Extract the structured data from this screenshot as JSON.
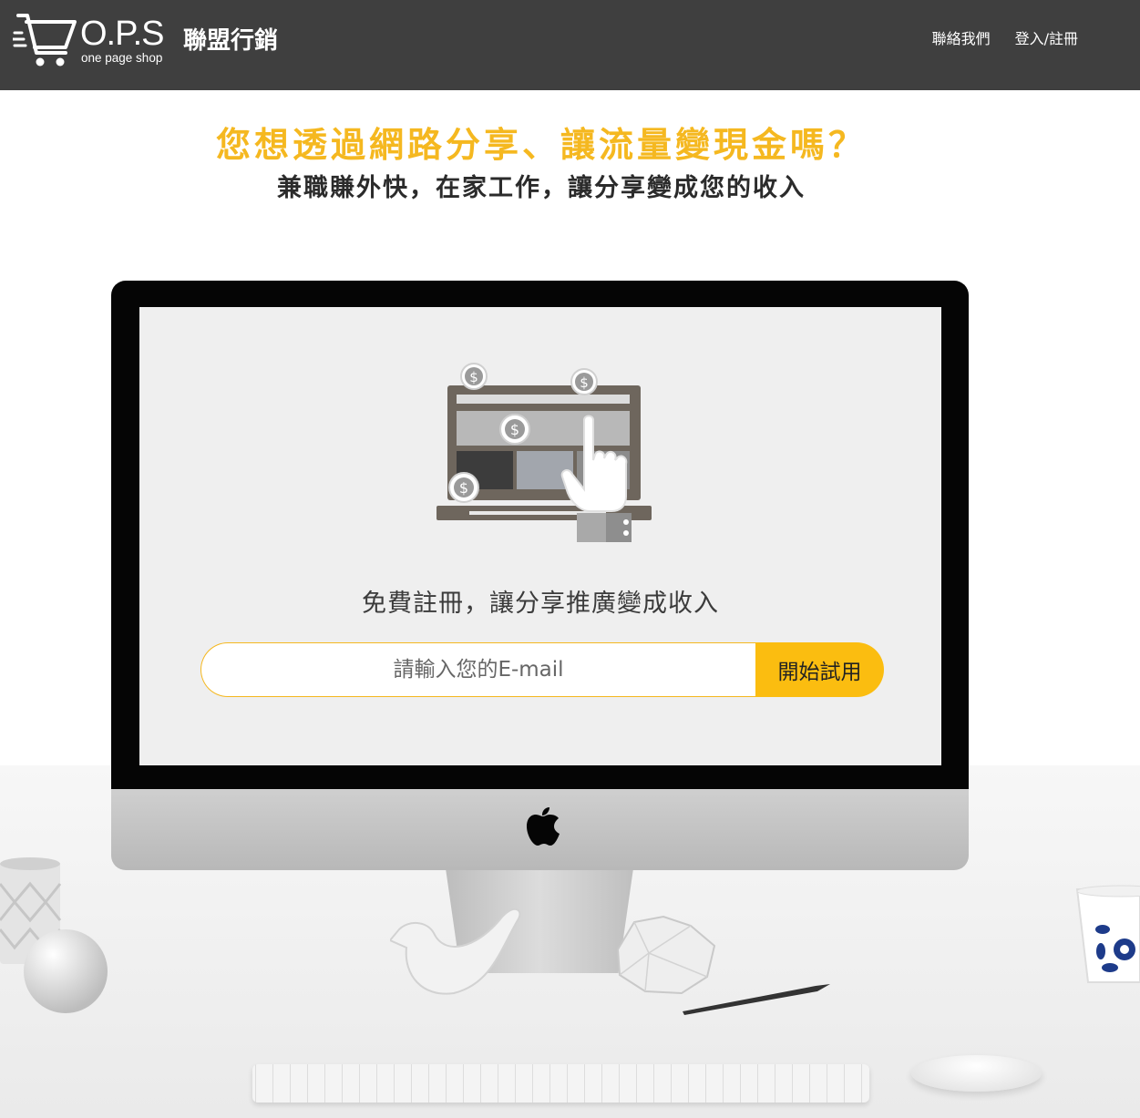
{
  "header": {
    "logo": {
      "brand": "O.P.S",
      "tagline": "one page shop"
    },
    "site_name": "聯盟行銷",
    "nav": [
      {
        "label": "聯絡我們"
      },
      {
        "label": "登入/註冊"
      }
    ]
  },
  "hero": {
    "headline": "您想透過網路分享、讓流量變現金嗎？",
    "subheadline": "兼職賺外快，在家工作，讓分享變成您的收入"
  },
  "signup": {
    "prompt": "免費註冊，讓分享推廣變成收入",
    "email_placeholder": "請輸入您的E-mail",
    "email_value": "",
    "button_label": "開始試用"
  },
  "icons": [
    "cart-icon",
    "dollar-coin-icon",
    "pointing-hand-icon",
    "apple-logo-icon"
  ],
  "colors": {
    "header_bg": "#3f3f3f",
    "accent": "#f5b820",
    "button_bg": "#fbbd10",
    "text_dark": "#2b2b2b"
  }
}
